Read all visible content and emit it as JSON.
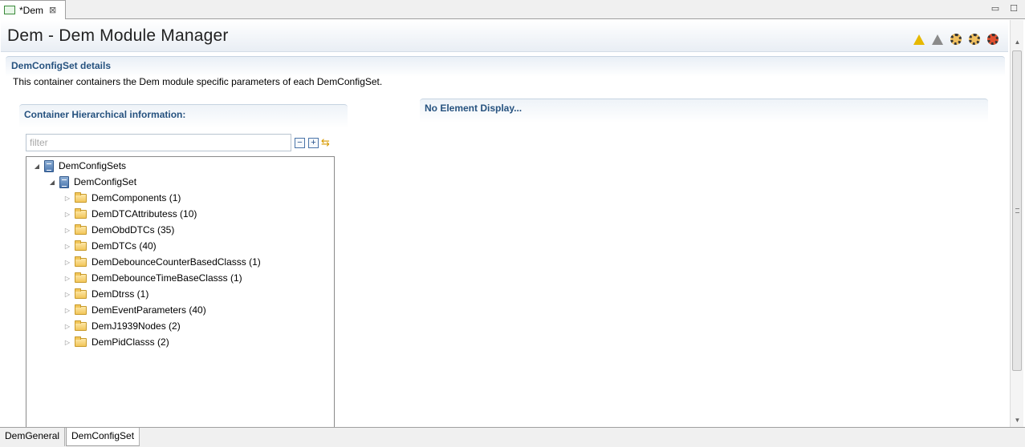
{
  "editor_tab": {
    "label": "*Dem",
    "close": "⊠"
  },
  "window_controls": {
    "minimize": "▭",
    "maximize": "☐"
  },
  "form": {
    "title": "Dem - Dem Module Manager",
    "header_icons": [
      "warning-icon",
      "warning-grey-icon",
      "gear-icon",
      "gears-icon",
      "gear-red-icon"
    ]
  },
  "section": {
    "title": "DemConfigSet details",
    "description": "This container containers the Dem module specific parameters of each DemConfigSet."
  },
  "hierarchy": {
    "title": "Container Hierarchical information:",
    "filter_placeholder": "filter",
    "collapse_label": "−",
    "expand_label": "+",
    "sync_label": "⇆",
    "tree": {
      "root": "DemConfigSets",
      "child": "DemConfigSet",
      "items": [
        "DemComponents (1)",
        "DemDTCAttributess (10)",
        "DemObdDTCs (35)",
        "DemDTCs (40)",
        "DemDebounceCounterBasedClasss (1)",
        "DemDebounceTimeBaseClasss (1)",
        "DemDtrss (1)",
        "DemEventParameters (40)",
        "DemJ1939Nodes (2)",
        "DemPidClasss (2)"
      ]
    }
  },
  "details_panel": {
    "title": "No Element Display..."
  },
  "page_tabs": [
    "DemGeneral",
    "DemConfigSet"
  ],
  "active_page_tab": "DemConfigSet"
}
